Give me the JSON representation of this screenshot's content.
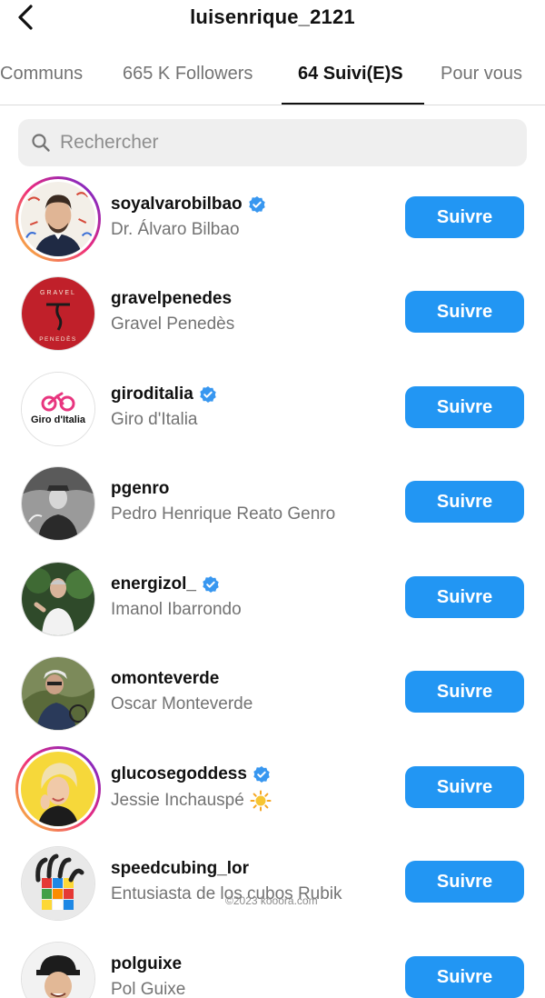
{
  "header": {
    "title": "luisenrique_2121",
    "back_icon": "chevron-left-icon"
  },
  "tabs": [
    {
      "label": "Communs",
      "active": false
    },
    {
      "label": "665 K Followers",
      "active": false
    },
    {
      "label": "64 Suivi(E)S",
      "active": true
    },
    {
      "label": "Pour vous",
      "active": false
    }
  ],
  "search": {
    "placeholder": "Rechercher",
    "value": "",
    "icon": "search-icon"
  },
  "follow_label": "Suivre",
  "accounts": [
    {
      "username": "soyalvarobilbao",
      "fullname": "Dr. Álvaro Bilbao",
      "verified": true,
      "story_ring": true
    },
    {
      "username": "gravelpenedes",
      "fullname": "Gravel Penedès",
      "verified": false,
      "story_ring": false
    },
    {
      "username": "giroditalia",
      "fullname": "Giro d'Italia",
      "verified": true,
      "story_ring": false
    },
    {
      "username": "pgenro",
      "fullname": "Pedro Henrique Reato Genro",
      "verified": false,
      "story_ring": false
    },
    {
      "username": "energizol_",
      "fullname": "Imanol Ibarrondo",
      "verified": true,
      "story_ring": false
    },
    {
      "username": "omonteverde",
      "fullname": "Oscar Monteverde",
      "verified": false,
      "story_ring": false
    },
    {
      "username": "glucosegoddess",
      "fullname": "Jessie Inchauspé",
      "verified": true,
      "story_ring": true,
      "emoji": "sun-icon"
    },
    {
      "username": "speedcubing_lor",
      "fullname": "Entusiasta de los cubos Rubik",
      "verified": false,
      "story_ring": false
    },
    {
      "username": "polguixe",
      "fullname": "Pol Guixe",
      "verified": false,
      "story_ring": false
    }
  ],
  "avatar_logos": {
    "gravel_top": "GRAVEL",
    "gravel_bottom": "PENEDÈS",
    "giro": "Giro d'Italia"
  },
  "watermark": "©2023 kooora.com",
  "colors": {
    "follow_button": "#2296f3",
    "verified_badge": "#3897f0",
    "story_ring": [
      "#f9ce34",
      "#ee2a7b",
      "#6228d7"
    ]
  }
}
